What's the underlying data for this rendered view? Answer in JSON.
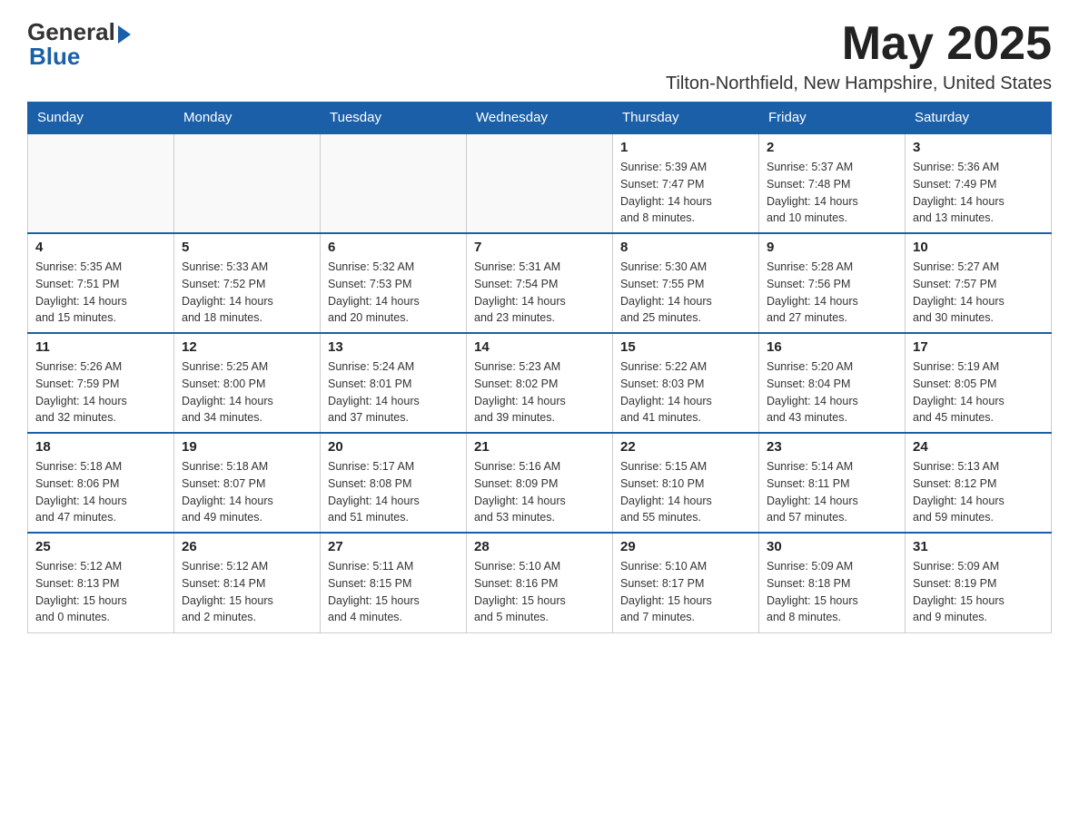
{
  "header": {
    "logo_general": "General",
    "logo_blue": "Blue",
    "month_title": "May 2025",
    "subtitle": "Tilton-Northfield, New Hampshire, United States"
  },
  "days_of_week": [
    "Sunday",
    "Monday",
    "Tuesday",
    "Wednesday",
    "Thursday",
    "Friday",
    "Saturday"
  ],
  "weeks": [
    [
      {
        "day": "",
        "info": ""
      },
      {
        "day": "",
        "info": ""
      },
      {
        "day": "",
        "info": ""
      },
      {
        "day": "",
        "info": ""
      },
      {
        "day": "1",
        "info": "Sunrise: 5:39 AM\nSunset: 7:47 PM\nDaylight: 14 hours\nand 8 minutes."
      },
      {
        "day": "2",
        "info": "Sunrise: 5:37 AM\nSunset: 7:48 PM\nDaylight: 14 hours\nand 10 minutes."
      },
      {
        "day": "3",
        "info": "Sunrise: 5:36 AM\nSunset: 7:49 PM\nDaylight: 14 hours\nand 13 minutes."
      }
    ],
    [
      {
        "day": "4",
        "info": "Sunrise: 5:35 AM\nSunset: 7:51 PM\nDaylight: 14 hours\nand 15 minutes."
      },
      {
        "day": "5",
        "info": "Sunrise: 5:33 AM\nSunset: 7:52 PM\nDaylight: 14 hours\nand 18 minutes."
      },
      {
        "day": "6",
        "info": "Sunrise: 5:32 AM\nSunset: 7:53 PM\nDaylight: 14 hours\nand 20 minutes."
      },
      {
        "day": "7",
        "info": "Sunrise: 5:31 AM\nSunset: 7:54 PM\nDaylight: 14 hours\nand 23 minutes."
      },
      {
        "day": "8",
        "info": "Sunrise: 5:30 AM\nSunset: 7:55 PM\nDaylight: 14 hours\nand 25 minutes."
      },
      {
        "day": "9",
        "info": "Sunrise: 5:28 AM\nSunset: 7:56 PM\nDaylight: 14 hours\nand 27 minutes."
      },
      {
        "day": "10",
        "info": "Sunrise: 5:27 AM\nSunset: 7:57 PM\nDaylight: 14 hours\nand 30 minutes."
      }
    ],
    [
      {
        "day": "11",
        "info": "Sunrise: 5:26 AM\nSunset: 7:59 PM\nDaylight: 14 hours\nand 32 minutes."
      },
      {
        "day": "12",
        "info": "Sunrise: 5:25 AM\nSunset: 8:00 PM\nDaylight: 14 hours\nand 34 minutes."
      },
      {
        "day": "13",
        "info": "Sunrise: 5:24 AM\nSunset: 8:01 PM\nDaylight: 14 hours\nand 37 minutes."
      },
      {
        "day": "14",
        "info": "Sunrise: 5:23 AM\nSunset: 8:02 PM\nDaylight: 14 hours\nand 39 minutes."
      },
      {
        "day": "15",
        "info": "Sunrise: 5:22 AM\nSunset: 8:03 PM\nDaylight: 14 hours\nand 41 minutes."
      },
      {
        "day": "16",
        "info": "Sunrise: 5:20 AM\nSunset: 8:04 PM\nDaylight: 14 hours\nand 43 minutes."
      },
      {
        "day": "17",
        "info": "Sunrise: 5:19 AM\nSunset: 8:05 PM\nDaylight: 14 hours\nand 45 minutes."
      }
    ],
    [
      {
        "day": "18",
        "info": "Sunrise: 5:18 AM\nSunset: 8:06 PM\nDaylight: 14 hours\nand 47 minutes."
      },
      {
        "day": "19",
        "info": "Sunrise: 5:18 AM\nSunset: 8:07 PM\nDaylight: 14 hours\nand 49 minutes."
      },
      {
        "day": "20",
        "info": "Sunrise: 5:17 AM\nSunset: 8:08 PM\nDaylight: 14 hours\nand 51 minutes."
      },
      {
        "day": "21",
        "info": "Sunrise: 5:16 AM\nSunset: 8:09 PM\nDaylight: 14 hours\nand 53 minutes."
      },
      {
        "day": "22",
        "info": "Sunrise: 5:15 AM\nSunset: 8:10 PM\nDaylight: 14 hours\nand 55 minutes."
      },
      {
        "day": "23",
        "info": "Sunrise: 5:14 AM\nSunset: 8:11 PM\nDaylight: 14 hours\nand 57 minutes."
      },
      {
        "day": "24",
        "info": "Sunrise: 5:13 AM\nSunset: 8:12 PM\nDaylight: 14 hours\nand 59 minutes."
      }
    ],
    [
      {
        "day": "25",
        "info": "Sunrise: 5:12 AM\nSunset: 8:13 PM\nDaylight: 15 hours\nand 0 minutes."
      },
      {
        "day": "26",
        "info": "Sunrise: 5:12 AM\nSunset: 8:14 PM\nDaylight: 15 hours\nand 2 minutes."
      },
      {
        "day": "27",
        "info": "Sunrise: 5:11 AM\nSunset: 8:15 PM\nDaylight: 15 hours\nand 4 minutes."
      },
      {
        "day": "28",
        "info": "Sunrise: 5:10 AM\nSunset: 8:16 PM\nDaylight: 15 hours\nand 5 minutes."
      },
      {
        "day": "29",
        "info": "Sunrise: 5:10 AM\nSunset: 8:17 PM\nDaylight: 15 hours\nand 7 minutes."
      },
      {
        "day": "30",
        "info": "Sunrise: 5:09 AM\nSunset: 8:18 PM\nDaylight: 15 hours\nand 8 minutes."
      },
      {
        "day": "31",
        "info": "Sunrise: 5:09 AM\nSunset: 8:19 PM\nDaylight: 15 hours\nand 9 minutes."
      }
    ]
  ]
}
